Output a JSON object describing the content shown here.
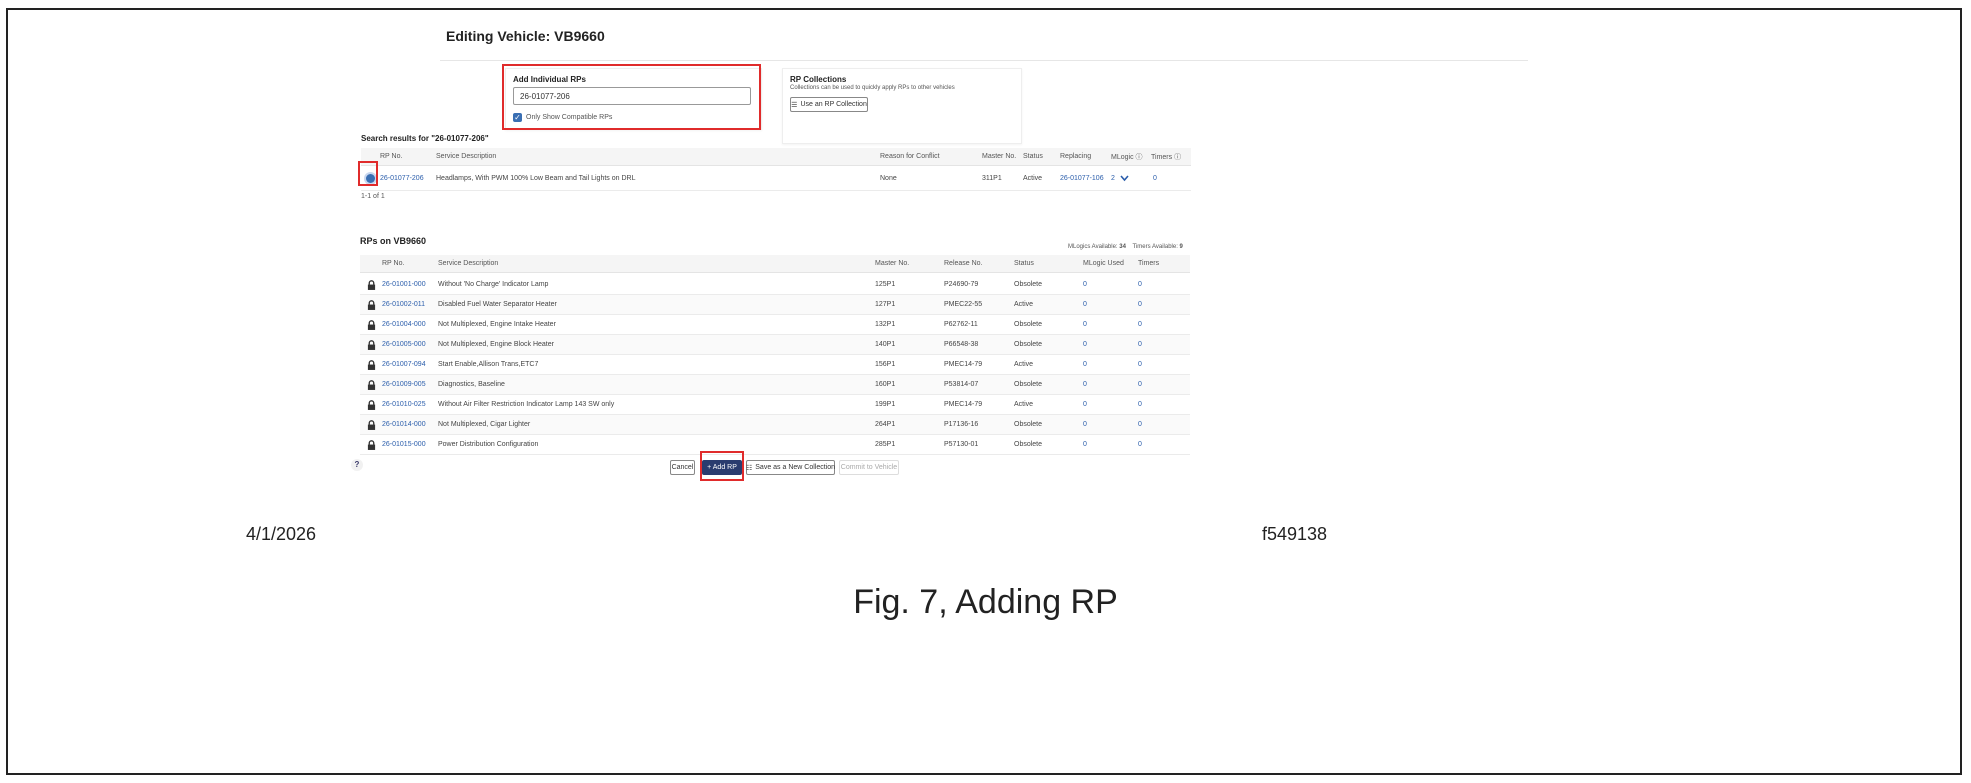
{
  "page_title": "Editing Vehicle: VB9660",
  "add_individual": {
    "heading": "Add Individual RPs",
    "input_value": "26-01077-206",
    "only_compatible_label": "Only Show Compatible RPs"
  },
  "rp_collections": {
    "heading": "RP Collections",
    "text": "Collections can be used to quickly apply RPs to other vehicles",
    "button_label": "Use an RP Collection"
  },
  "search": {
    "heading": "Search results for \"26-01077-206\"",
    "columns": [
      "RP No.",
      "Service Description",
      "Reason for Conflict",
      "Master No.",
      "Status",
      "Replacing",
      "MLogic ⓘ",
      "Timers ⓘ"
    ],
    "rows": [
      {
        "rp_no": "26-01077-206",
        "description": "Headlamps, With PWM 100% Low Beam and Tail Lights on DRL",
        "reason": "None",
        "master": "311P1",
        "status": "Active",
        "replacing": "26-01077-106",
        "mlogic": "2",
        "timers": "0"
      }
    ],
    "pagination": "1-1 of 1"
  },
  "rps_on_vehicle": {
    "heading": "RPs on VB9660",
    "mlogics_label": "MLogics Available:",
    "mlogics_value": "34",
    "timers_label": "Timers Available:",
    "timers_value": "9",
    "columns": [
      "RP No.",
      "Service Description",
      "Master No.",
      "Release No.",
      "Status",
      "MLogic Used",
      "Timers"
    ],
    "rows": [
      {
        "rp_no": "26-01001-000",
        "description": "Without 'No Charge' Indicator Lamp",
        "master": "125P1",
        "release": "P24690-79",
        "status": "Obsolete",
        "mlogic": "0",
        "timers": "0"
      },
      {
        "rp_no": "26-01002-011",
        "description": "Disabled Fuel Water Separator Heater",
        "master": "127P1",
        "release": "PMEC22-55",
        "status": "Active",
        "mlogic": "0",
        "timers": "0"
      },
      {
        "rp_no": "26-01004-000",
        "description": "Not Multiplexed, Engine Intake Heater",
        "master": "132P1",
        "release": "P62762-11",
        "status": "Obsolete",
        "mlogic": "0",
        "timers": "0"
      },
      {
        "rp_no": "26-01005-000",
        "description": "Not Multiplexed, Engine Block Heater",
        "master": "140P1",
        "release": "P66548-38",
        "status": "Obsolete",
        "mlogic": "0",
        "timers": "0"
      },
      {
        "rp_no": "26-01007-094",
        "description": "Start Enable,Allison Trans,ETC7",
        "master": "156P1",
        "release": "PMEC14-79",
        "status": "Active",
        "mlogic": "0",
        "timers": "0"
      },
      {
        "rp_no": "26-01009-005",
        "description": "Diagnostics, Baseline",
        "master": "160P1",
        "release": "P53814-07",
        "status": "Obsolete",
        "mlogic": "0",
        "timers": "0"
      },
      {
        "rp_no": "26-01010-025",
        "description": "Without Air Filter Restriction Indicator Lamp 143 SW only",
        "master": "199P1",
        "release": "PMEC14-79",
        "status": "Active",
        "mlogic": "0",
        "timers": "0"
      },
      {
        "rp_no": "26-01014-000",
        "description": "Not Multiplexed, Cigar Lighter",
        "master": "264P1",
        "release": "P17136-16",
        "status": "Obsolete",
        "mlogic": "0",
        "timers": "0"
      },
      {
        "rp_no": "26-01015-000",
        "description": "Power Distribution Configuration",
        "master": "285P1",
        "release": "P57130-01",
        "status": "Obsolete",
        "mlogic": "0",
        "timers": "0"
      }
    ]
  },
  "actions": {
    "cancel": "Cancel",
    "add_rp": "+ Add RP",
    "save_collection": "Save as a New Collection",
    "commit": "Commit to Vehicle",
    "help": "?"
  },
  "footer": {
    "date": "4/1/2026",
    "figure_id": "f549138",
    "caption": "Fig. 7, Adding RP"
  },
  "colors": {
    "link": "#2a5dab",
    "highlight": "#e02b2b",
    "primary": "#2a3c6f"
  },
  "icons": {
    "lock": "lock-icon",
    "list": "list-icon",
    "chevron": "chevron-down-icon",
    "radio": "radio-selected-icon"
  }
}
